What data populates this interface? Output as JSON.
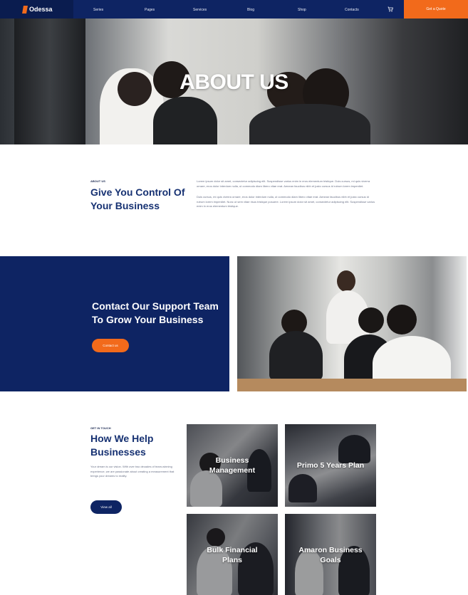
{
  "nav": {
    "brand": "Odessa",
    "items": [
      "Series",
      "Pages",
      "Services",
      "Blog",
      "Shop",
      "Contacts"
    ],
    "cta_label": "Get a Quote"
  },
  "hero": {
    "title": "ABOUT US"
  },
  "about": {
    "kicker": "ABOUT US",
    "title": "Give You Control Of Your Business",
    "paragraphs": [
      "Lorem ipsum dolor sit amet, consectetur adipiscing elit. Suspendisse varius enim in eros elementum tristique. Duis cursus, mi quis viverra ornare, eros dolor interdum nulla, ut commodo diam libero vitae erat. Aenean faucibus nibh et justo cursus id rutrum lorem imperdiet.",
      "Duis cursus, mi quis viverra ornare, eros dolor interdum nulla, ut commodo diam libero vitae erat. Aenean faucibus nibh et justo cursus id rutrum lorem imperdiet. Nunc ut sem vitae risus tristique posuere. Lorem ipsum dolor sit amet, consectetur adipiscing elit. Suspendisse varius enim in eros elementum tristique."
    ]
  },
  "contact": {
    "title": "Contact Our Support Team To Grow Your Business",
    "button": "Contact us"
  },
  "help": {
    "kicker": "GET IN TOUCH",
    "title": "How We Help Businesses",
    "text": "Your dream is our vision. With over two decades of team-winning experience, we are passionate about creating a measurement that brings your dreams to reality.",
    "button": "View all",
    "cards": [
      "Business Management",
      "Primo 5 Years Plan",
      "Bulk Financial Plans",
      "Amaron Business Goals"
    ]
  },
  "colors": {
    "navy": "#0e2463",
    "accent": "#f26a1b",
    "heading": "#163172"
  }
}
